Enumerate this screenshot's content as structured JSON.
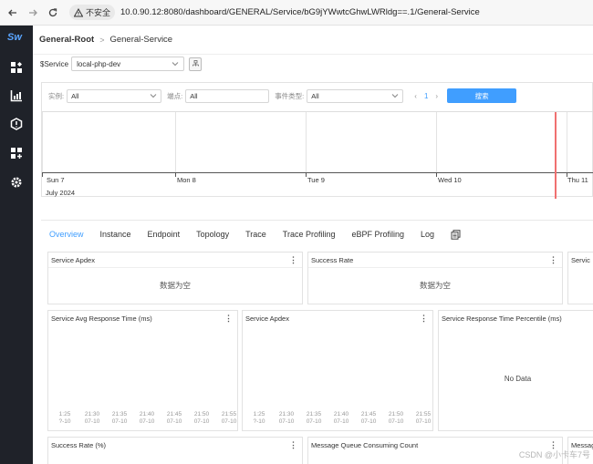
{
  "browser": {
    "security_label": "不安全",
    "url": "10.0.90.12:8080/dashboard/GENERAL/Service/bG9jYWwtcGhwLWRldg==.1/General-Service"
  },
  "sidebar": {
    "logo": "Sw",
    "icons": [
      "dashboard-icon",
      "chart-icon",
      "alert-icon",
      "marketplace-icon",
      "settings-icon"
    ]
  },
  "breadcrumb": {
    "root": "General-Root",
    "separator": ">",
    "current": "General-Service"
  },
  "service_selector": {
    "label": "$Service",
    "value": "local-php-dev"
  },
  "filters": {
    "instance_label": "实例:",
    "instance_value": "All",
    "endpoint_label": "端点:",
    "endpoint_value": "All",
    "event_type_label": "事件类型:",
    "event_type_value": "All",
    "page": "1",
    "search_label": "搜索"
  },
  "timeline": {
    "days": [
      "Sun 7",
      "Mon 8",
      "Tue 9",
      "Wed 10",
      "Thu 11"
    ],
    "month": "July 2024"
  },
  "tabs": [
    "Overview",
    "Instance",
    "Endpoint",
    "Topology",
    "Trace",
    "Trace Profiling",
    "eBPF Profiling",
    "Log"
  ],
  "active_tab": "Overview",
  "widgets": {
    "apdex_top": {
      "title": "Service Apdex",
      "empty": "数据为空"
    },
    "success_rate_top": {
      "title": "Success Rate",
      "empty": "数据为空"
    },
    "third_top": {
      "title": "Servic"
    },
    "avg_response": {
      "title": "Service Avg Response Time (ms)"
    },
    "apdex_mid": {
      "title": "Service Apdex"
    },
    "percentile": {
      "title": "Service Response Time Percentile (ms)",
      "no_data": "No Data"
    },
    "success_rate_pct": {
      "title": "Success Rate (%)"
    },
    "mq_consuming": {
      "title": "Message Queue Consuming Count"
    },
    "mq_partial": {
      "title": "Messag"
    },
    "menu_glyph": "⋮"
  },
  "axis_times": [
    [
      "1:25",
      "?-10"
    ],
    [
      "21:30",
      "07-10"
    ],
    [
      "21:35",
      "07-10"
    ],
    [
      "21:40",
      "07-10"
    ],
    [
      "21:45",
      "07-10"
    ],
    [
      "21:50",
      "07-10"
    ],
    [
      "21:55",
      "07-10"
    ]
  ],
  "watermark": "CSDN @小卡车7号",
  "colors": {
    "primary": "#409eff",
    "sidebar": "#1f2229",
    "now_line": "#f07070"
  }
}
